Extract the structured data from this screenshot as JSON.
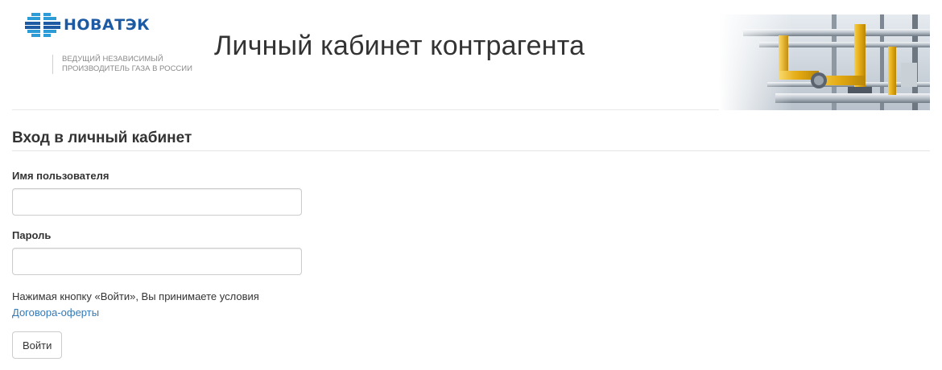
{
  "header": {
    "logo_text": "НОВАТЭК",
    "tagline_line1": "ВЕДУЩИЙ НЕЗАВИСИМЫЙ",
    "tagline_line2": "ПРОИЗВОДИТЕЛЬ ГАЗА В РОССИИ",
    "page_title": "Личный кабинет контрагента"
  },
  "login": {
    "section_title": "Вход в личный кабинет",
    "username_label": "Имя пользователя",
    "username_value": "",
    "password_label": "Пароль",
    "password_value": "",
    "notice_text": "Нажимая кнопку «Войти», Вы принимаете условия",
    "notice_link": "Договора-оферты",
    "submit_label": "Войти"
  },
  "colors": {
    "brand": "#1c5aa3",
    "link": "#337ab7",
    "pipe_yellow": "#e8b81e"
  }
}
